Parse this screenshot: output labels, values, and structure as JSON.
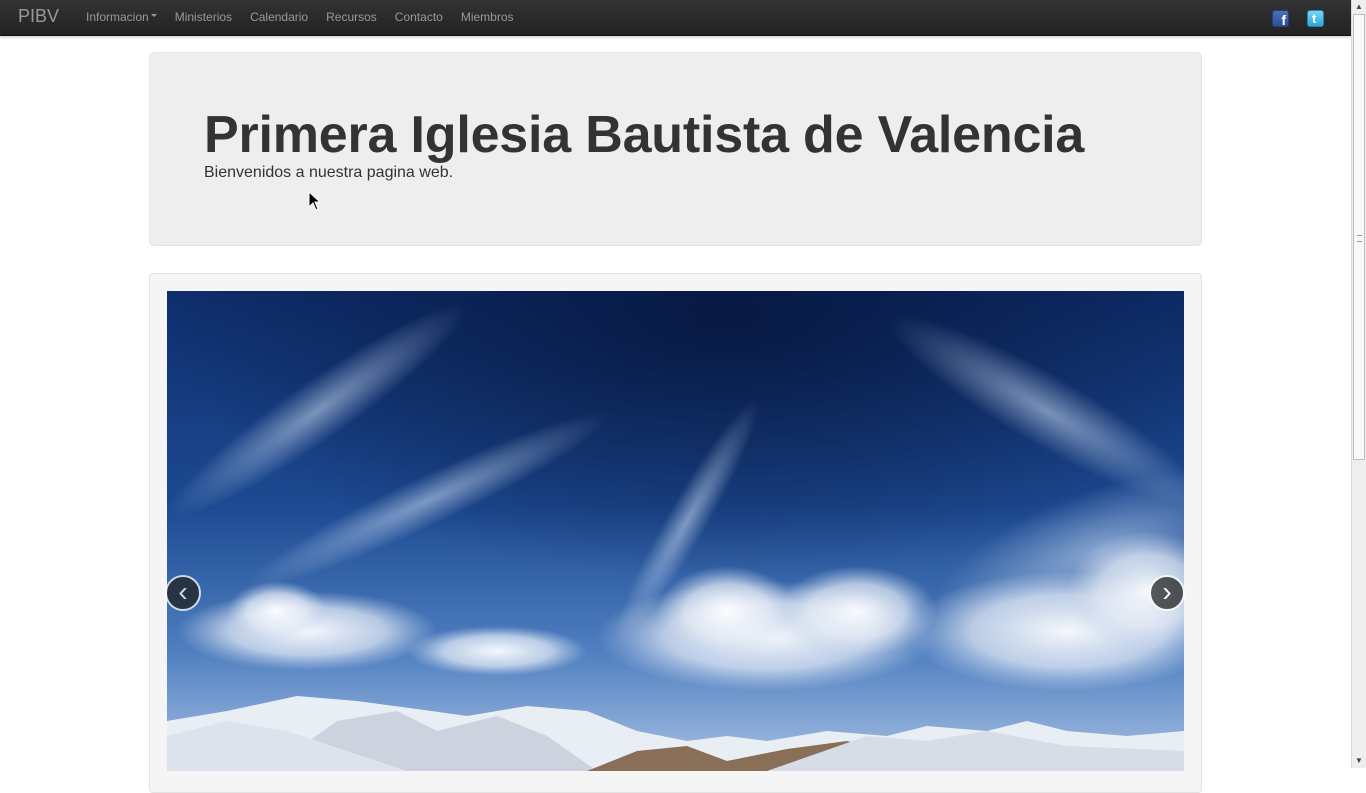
{
  "navbar": {
    "brand": "PIBV",
    "items": [
      {
        "label": "Informacion",
        "dropdown": true
      },
      {
        "label": "Ministerios"
      },
      {
        "label": "Calendario"
      },
      {
        "label": "Recursos"
      },
      {
        "label": "Contacto"
      },
      {
        "label": "Miembros"
      }
    ],
    "social": {
      "facebook_glyph": "f",
      "twitter_glyph": "t"
    }
  },
  "hero": {
    "title": "Primera Iglesia Bautista de Valencia",
    "subtitle": "Bienvenidos a nuestra pagina web."
  },
  "carousel": {
    "prev_glyph": "‹",
    "next_glyph": "›",
    "image": "sky-and-snowy-mountains"
  },
  "colors": {
    "navbar": "#222222",
    "hero_bg": "#eeeeee",
    "sky": "#1a3f7a"
  }
}
